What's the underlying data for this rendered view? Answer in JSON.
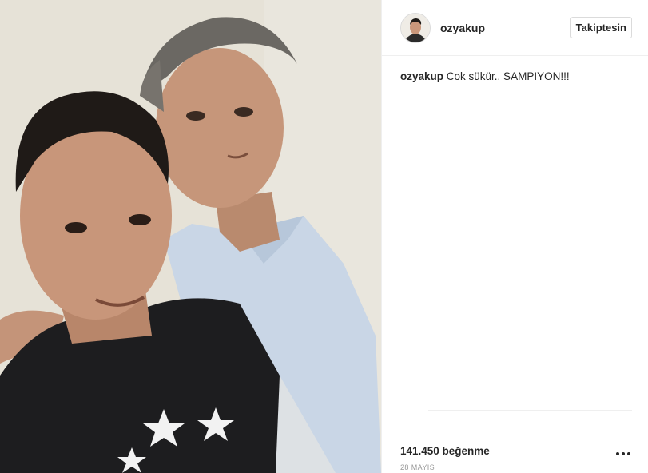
{
  "post": {
    "username": "ozyakup",
    "follow_label": "Takiptesin",
    "caption_author": "ozyakup",
    "caption_text": "Cok sükür.. SAMPIYON!!!",
    "likes": "141.450 beğenme",
    "date": "28 MAYIS"
  },
  "icons": {
    "more": "more-options-icon"
  }
}
